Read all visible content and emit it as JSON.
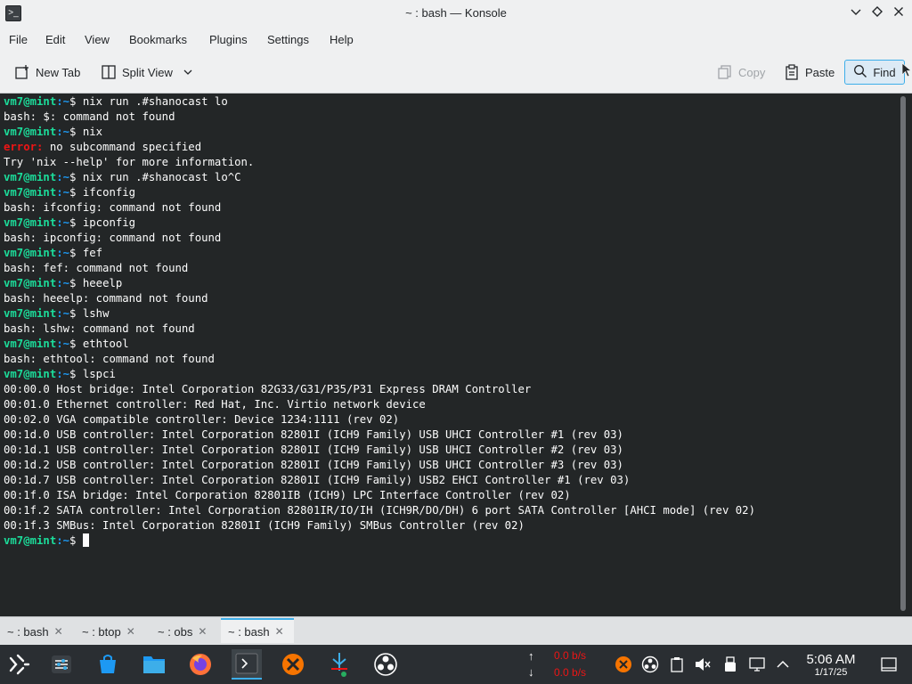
{
  "window": {
    "title": "~ : bash — Konsole"
  },
  "menu": [
    "File",
    "Edit",
    "View",
    "Bookmarks",
    "Plugins",
    "Settings",
    "Help"
  ],
  "toolbar": {
    "new_tab": "New Tab",
    "split_view": "Split View",
    "copy": "Copy",
    "paste": "Paste",
    "find": "Find"
  },
  "terminal": {
    "prompt_user": "vm7@mint",
    "prompt_path": ":~",
    "prompt_symbol": "$",
    "lines": [
      {
        "type": "prompt",
        "cmd": " nix run .#shanocast lo"
      },
      {
        "type": "out",
        "text": "bash: $: command not found"
      },
      {
        "type": "prompt",
        "cmd": " nix"
      },
      {
        "type": "err",
        "label": "error:",
        "text": " no subcommand specified"
      },
      {
        "type": "out",
        "text": "Try 'nix --help' for more information."
      },
      {
        "type": "prompt",
        "cmd": " nix run .#shanocast lo^C"
      },
      {
        "type": "prompt",
        "cmd": " ifconfig"
      },
      {
        "type": "out",
        "text": "bash: ifconfig: command not found"
      },
      {
        "type": "prompt",
        "cmd": " ipconfig"
      },
      {
        "type": "out",
        "text": "bash: ipconfig: command not found"
      },
      {
        "type": "prompt",
        "cmd": " fef"
      },
      {
        "type": "out",
        "text": "bash: fef: command not found"
      },
      {
        "type": "prompt",
        "cmd": " heeelp"
      },
      {
        "type": "out",
        "text": "bash: heeelp: command not found"
      },
      {
        "type": "prompt",
        "cmd": " lshw"
      },
      {
        "type": "out",
        "text": "bash: lshw: command not found"
      },
      {
        "type": "prompt",
        "cmd": " ethtool"
      },
      {
        "type": "out",
        "text": "bash: ethtool: command not found"
      },
      {
        "type": "prompt",
        "cmd": " lspci"
      },
      {
        "type": "out",
        "text": "00:00.0 Host bridge: Intel Corporation 82G33/G31/P35/P31 Express DRAM Controller"
      },
      {
        "type": "out",
        "text": "00:01.0 Ethernet controller: Red Hat, Inc. Virtio network device"
      },
      {
        "type": "out",
        "text": "00:02.0 VGA compatible controller: Device 1234:1111 (rev 02)"
      },
      {
        "type": "out",
        "text": "00:1d.0 USB controller: Intel Corporation 82801I (ICH9 Family) USB UHCI Controller #1 (rev 03)"
      },
      {
        "type": "out",
        "text": "00:1d.1 USB controller: Intel Corporation 82801I (ICH9 Family) USB UHCI Controller #2 (rev 03)"
      },
      {
        "type": "out",
        "text": "00:1d.2 USB controller: Intel Corporation 82801I (ICH9 Family) USB UHCI Controller #3 (rev 03)"
      },
      {
        "type": "out",
        "text": "00:1d.7 USB controller: Intel Corporation 82801I (ICH9 Family) USB2 EHCI Controller #1 (rev 03)"
      },
      {
        "type": "out",
        "text": "00:1f.0 ISA bridge: Intel Corporation 82801IB (ICH9) LPC Interface Controller (rev 02)"
      },
      {
        "type": "out",
        "text": "00:1f.2 SATA controller: Intel Corporation 82801IR/IO/IH (ICH9R/DO/DH) 6 port SATA Controller [AHCI mode] (rev 02)"
      },
      {
        "type": "out",
        "text": "00:1f.3 SMBus: Intel Corporation 82801I (ICH9 Family) SMBus Controller (rev 02)"
      },
      {
        "type": "prompt",
        "cmd": " ",
        "cursor": true
      }
    ]
  },
  "tabs": [
    {
      "label": "~ : bash",
      "active": false
    },
    {
      "label": "~ : btop",
      "active": false
    },
    {
      "label": "~ : obs",
      "active": false
    },
    {
      "label": "~ : bash",
      "active": true
    }
  ],
  "taskbar": {
    "net_up": "0.0 b/s",
    "net_down": "0.0 b/s",
    "time": "5:06 AM",
    "date": "1/17/25"
  },
  "colors": {
    "accent": "#3daee9",
    "prompt_user": "#1cdc9a",
    "prompt_path": "#1d99f3",
    "error": "#ed1515",
    "net_value": "#ed1515"
  }
}
